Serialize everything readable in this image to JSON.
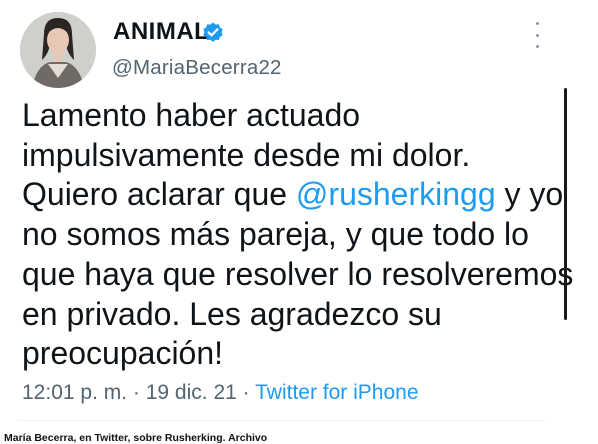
{
  "tweet": {
    "author_name": "ANIMAL",
    "author_handle": "@MariaBecerra22",
    "verified": true,
    "text_lines": [
      {
        "before": "Lamento haber actuado",
        "mention": "",
        "after": ""
      },
      {
        "before": "impulsivamente desde mi dolor.",
        "mention": "",
        "after": ""
      },
      {
        "before": "Quiero aclarar que ",
        "mention": "@rusherkingg",
        "after": " y yo"
      },
      {
        "before": "no somos más pareja, y que todo lo",
        "mention": "",
        "after": ""
      },
      {
        "before": "que haya que resolver lo resolveremos",
        "mention": "",
        "after": ""
      },
      {
        "before": "en privado. Les agradezco su",
        "mention": "",
        "after": ""
      },
      {
        "before": "preocupación!",
        "mention": "",
        "after": ""
      }
    ],
    "time": "12:01 p. m.",
    "separator": " · ",
    "date": "19 dic. 21",
    "source": "Twitter for iPhone"
  },
  "icons": {
    "verified": "verified-badge-icon",
    "more": "more-options-icon"
  },
  "colors": {
    "link": "#1d9bf0",
    "secondary_text": "#536471",
    "primary_text": "#0f1419"
  },
  "caption": "María Becerra, en Twitter, sobre Rusherking. Archivo"
}
